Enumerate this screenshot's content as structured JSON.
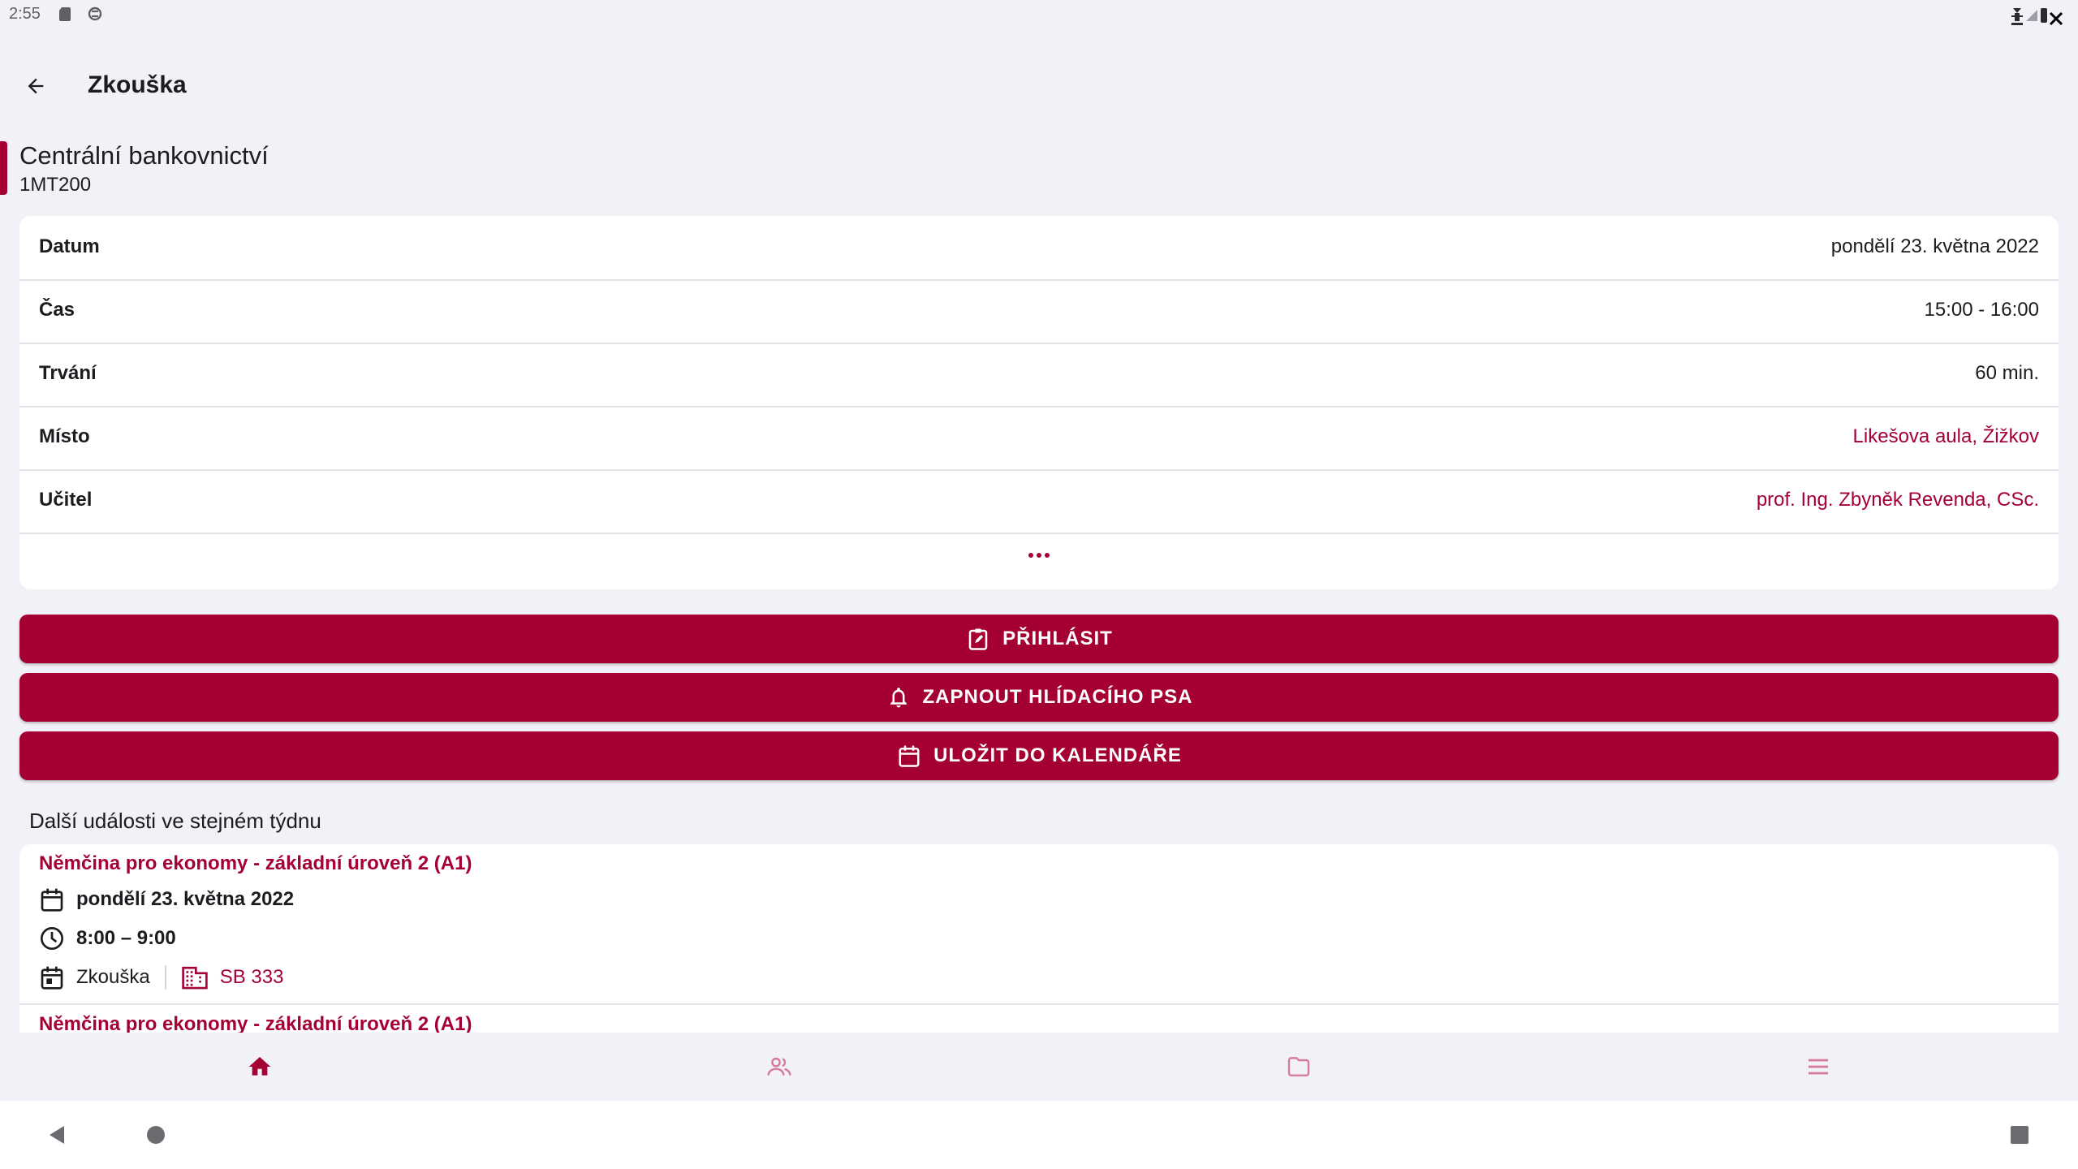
{
  "status_bar": {
    "time": "2:55"
  },
  "app_bar": {
    "title": "Zkouška"
  },
  "subject": {
    "name": "Centrální bankovnictví",
    "code": "1MT200"
  },
  "details": [
    {
      "label": "Datum",
      "value": "pondělí 23. května 2022"
    },
    {
      "label": "Čas",
      "value": "15:00 - 16:00"
    },
    {
      "label": "Trvání",
      "value": "60 min."
    },
    {
      "label": "Místo",
      "value": "Likešova aula, Žižkov"
    },
    {
      "label": "Učitel",
      "value": "prof. Ing. Zbyněk Revenda, CSc."
    }
  ],
  "buttons": {
    "register": "PŘIHLÁSIT",
    "watchdog": "ZAPNOUT HLÍDACÍHO PSA",
    "calendar": "ULOŽIT DO KALENDÁŘE"
  },
  "other_events": {
    "title": "Další události ve stejném týdnu",
    "items": [
      {
        "title": "Němčina pro ekonomy - základní úroveň 2 (A1)",
        "date": "pondělí 23. května 2022",
        "time": "8:00 – 9:00",
        "type": "Zkouška",
        "room": "SB 333"
      },
      {
        "title": "Němčina pro ekonomy - základní úroveň 2 (A1)"
      }
    ]
  },
  "colors": {
    "accent": "#a50034",
    "background": "#f2f1f7",
    "card": "#ffffff"
  },
  "icons": {
    "bottom_nav": [
      "home-icon",
      "people-icon",
      "folder-icon",
      "menu-icon"
    ],
    "system_nav": [
      "back-triangle-icon",
      "home-circle-icon",
      "recents-square-icon"
    ]
  }
}
